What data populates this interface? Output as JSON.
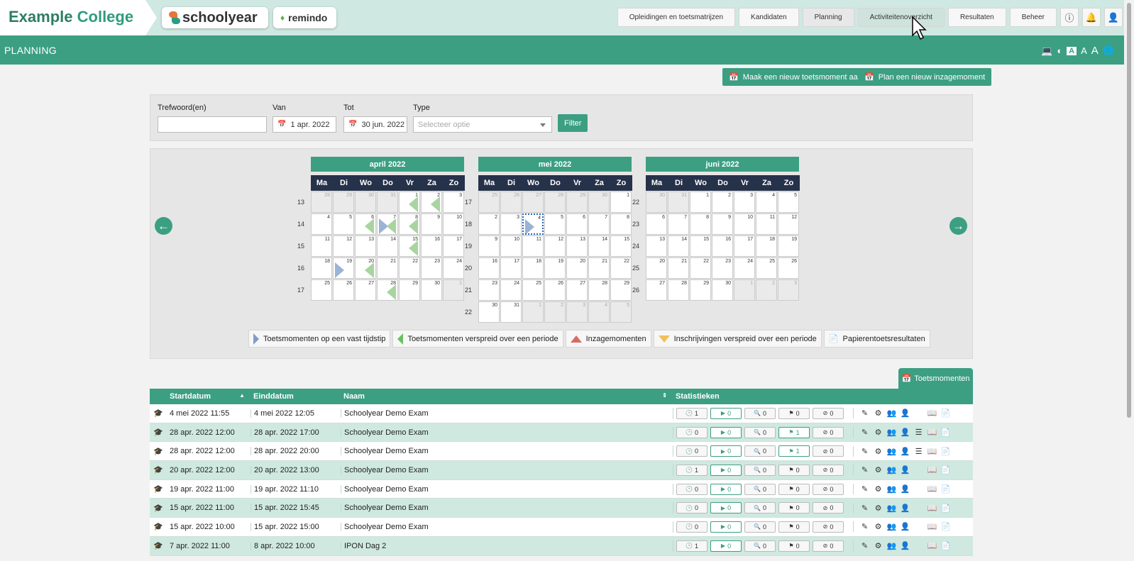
{
  "header": {
    "college_part1": "Example",
    "college_part2": "College",
    "logo_schoolyear": "schoolyear",
    "logo_remindo": "remindo",
    "nav": [
      {
        "label": "Opleidingen en toetsmatrijzen"
      },
      {
        "label": "Kandidaten"
      },
      {
        "label": "Planning"
      },
      {
        "label": "Activiteitenoverzicht"
      },
      {
        "label": "Resultaten"
      },
      {
        "label": "Beheer"
      }
    ],
    "nav_icons": [
      "info-icon",
      "bell-icon",
      "user-icon"
    ]
  },
  "subbar": {
    "title": "PLANNING",
    "tools": [
      "laptop-icon",
      "contrast-icon",
      "font-normal-icon",
      "font-large-icon",
      "font-larger-icon",
      "globe-icon"
    ]
  },
  "actions": {
    "new_test": "Maak een nieuw toetsmoment aan",
    "new_review": "Plan een nieuw inzagemoment"
  },
  "filter": {
    "keyword_label": "Trefwoord(en)",
    "keyword_value": "",
    "from_label": "Van",
    "from_value": "1 apr. 2022",
    "to_label": "Tot",
    "to_value": "30 jun. 2022",
    "type_label": "Type",
    "type_placeholder": "Selecteer optie",
    "filter_button": "Filter"
  },
  "calendar": {
    "day_headers": [
      "Ma",
      "Di",
      "Wo",
      "Do",
      "Vr",
      "Za",
      "Zo"
    ],
    "months": [
      {
        "title": "april 2022",
        "weeks": [
          {
            "wn": "13",
            "days": [
              [
                "28",
                0,
                ""
              ],
              [
                "29",
                0,
                ""
              ],
              [
                "30",
                0,
                ""
              ],
              [
                "31",
                0,
                ""
              ],
              [
                "1",
                1,
                "l"
              ],
              [
                "2",
                1,
                "l"
              ],
              [
                "3",
                1,
                ""
              ]
            ]
          },
          {
            "wn": "14",
            "days": [
              [
                "4",
                1,
                ""
              ],
              [
                "5",
                1,
                ""
              ],
              [
                "6",
                1,
                "l"
              ],
              [
                "7",
                1,
                "rl"
              ],
              [
                "8",
                1,
                "l"
              ],
              [
                "9",
                1,
                ""
              ],
              [
                "10",
                1,
                ""
              ]
            ]
          },
          {
            "wn": "15",
            "days": [
              [
                "11",
                1,
                ""
              ],
              [
                "12",
                1,
                ""
              ],
              [
                "13",
                1,
                ""
              ],
              [
                "14",
                1,
                ""
              ],
              [
                "15",
                1,
                "l"
              ],
              [
                "16",
                1,
                ""
              ],
              [
                "17",
                1,
                ""
              ]
            ]
          },
          {
            "wn": "16",
            "days": [
              [
                "18",
                1,
                ""
              ],
              [
                "19",
                1,
                "r"
              ],
              [
                "20",
                1,
                "l"
              ],
              [
                "21",
                1,
                ""
              ],
              [
                "22",
                1,
                ""
              ],
              [
                "23",
                1,
                ""
              ],
              [
                "24",
                1,
                ""
              ]
            ]
          },
          {
            "wn": "17",
            "days": [
              [
                "25",
                1,
                ""
              ],
              [
                "26",
                1,
                ""
              ],
              [
                "27",
                1,
                ""
              ],
              [
                "28",
                1,
                "l"
              ],
              [
                "29",
                1,
                ""
              ],
              [
                "30",
                1,
                ""
              ],
              [
                "1",
                0,
                ""
              ]
            ]
          }
        ]
      },
      {
        "title": "mei 2022",
        "weeks": [
          {
            "wn": "17",
            "days": [
              [
                "25",
                0,
                ""
              ],
              [
                "26",
                0,
                ""
              ],
              [
                "27",
                0,
                ""
              ],
              [
                "28",
                0,
                ""
              ],
              [
                "29",
                0,
                ""
              ],
              [
                "30",
                0,
                ""
              ],
              [
                "1",
                1,
                ""
              ]
            ]
          },
          {
            "wn": "18",
            "days": [
              [
                "2",
                1,
                ""
              ],
              [
                "3",
                1,
                ""
              ],
              [
                "4",
                1,
                "rs"
              ],
              [
                "5",
                1,
                ""
              ],
              [
                "6",
                1,
                ""
              ],
              [
                "7",
                1,
                ""
              ],
              [
                "8",
                1,
                ""
              ]
            ]
          },
          {
            "wn": "19",
            "days": [
              [
                "9",
                1,
                ""
              ],
              [
                "10",
                1,
                ""
              ],
              [
                "11",
                1,
                ""
              ],
              [
                "12",
                1,
                ""
              ],
              [
                "13",
                1,
                ""
              ],
              [
                "14",
                1,
                ""
              ],
              [
                "15",
                1,
                ""
              ]
            ]
          },
          {
            "wn": "20",
            "days": [
              [
                "16",
                1,
                ""
              ],
              [
                "17",
                1,
                ""
              ],
              [
                "18",
                1,
                ""
              ],
              [
                "19",
                1,
                ""
              ],
              [
                "20",
                1,
                ""
              ],
              [
                "21",
                1,
                ""
              ],
              [
                "22",
                1,
                ""
              ]
            ]
          },
          {
            "wn": "21",
            "days": [
              [
                "23",
                1,
                ""
              ],
              [
                "24",
                1,
                ""
              ],
              [
                "25",
                1,
                ""
              ],
              [
                "26",
                1,
                ""
              ],
              [
                "27",
                1,
                ""
              ],
              [
                "28",
                1,
                ""
              ],
              [
                "29",
                1,
                ""
              ]
            ]
          },
          {
            "wn": "22",
            "days": [
              [
                "30",
                1,
                ""
              ],
              [
                "31",
                1,
                ""
              ],
              [
                "1",
                0,
                ""
              ],
              [
                "2",
                0,
                ""
              ],
              [
                "3",
                0,
                ""
              ],
              [
                "4",
                0,
                ""
              ],
              [
                "5",
                0,
                ""
              ]
            ]
          }
        ]
      },
      {
        "title": "juni 2022",
        "weeks": [
          {
            "wn": "22",
            "days": [
              [
                "30",
                0,
                ""
              ],
              [
                "31",
                0,
                ""
              ],
              [
                "1",
                1,
                ""
              ],
              [
                "2",
                1,
                ""
              ],
              [
                "3",
                1,
                ""
              ],
              [
                "4",
                1,
                ""
              ],
              [
                "5",
                1,
                ""
              ]
            ]
          },
          {
            "wn": "23",
            "days": [
              [
                "6",
                1,
                ""
              ],
              [
                "7",
                1,
                ""
              ],
              [
                "8",
                1,
                ""
              ],
              [
                "9",
                1,
                ""
              ],
              [
                "10",
                1,
                ""
              ],
              [
                "11",
                1,
                ""
              ],
              [
                "12",
                1,
                ""
              ]
            ]
          },
          {
            "wn": "24",
            "days": [
              [
                "13",
                1,
                ""
              ],
              [
                "14",
                1,
                ""
              ],
              [
                "15",
                1,
                ""
              ],
              [
                "16",
                1,
                ""
              ],
              [
                "17",
                1,
                ""
              ],
              [
                "18",
                1,
                ""
              ],
              [
                "19",
                1,
                ""
              ]
            ]
          },
          {
            "wn": "25",
            "days": [
              [
                "20",
                1,
                ""
              ],
              [
                "21",
                1,
                ""
              ],
              [
                "22",
                1,
                ""
              ],
              [
                "23",
                1,
                ""
              ],
              [
                "24",
                1,
                ""
              ],
              [
                "25",
                1,
                ""
              ],
              [
                "26",
                1,
                ""
              ]
            ]
          },
          {
            "wn": "26",
            "days": [
              [
                "27",
                1,
                ""
              ],
              [
                "28",
                1,
                ""
              ],
              [
                "29",
                1,
                ""
              ],
              [
                "30",
                1,
                ""
              ],
              [
                "1",
                0,
                ""
              ],
              [
                "2",
                0,
                ""
              ],
              [
                "3",
                0,
                ""
              ]
            ]
          }
        ]
      }
    ]
  },
  "legend": {
    "fixed": "Toetsmomenten op een vast tijdstip",
    "spread": "Toetsmomenten verspreid over een periode",
    "review": "Inzagemomenten",
    "registrations": "Inschrijvingen verspreid over een periode",
    "paper": "Papierentoetsresultaten"
  },
  "table": {
    "tab_label": "Toetsmomenten",
    "headers": {
      "start": "Startdatum",
      "end": "Einddatum",
      "name": "Naam",
      "stats": "Statistieken"
    },
    "rows": [
      {
        "start": "4 mei 2022 11:55",
        "end": "4 mei 2022 12:05",
        "name": "Schoolyear Demo Exam",
        "s": [
          "1",
          "0",
          "0",
          "0",
          "0"
        ],
        "flag_green": false,
        "list": false
      },
      {
        "start": "28 apr. 2022 12:00",
        "end": "28 apr. 2022 17:00",
        "name": "Schoolyear Demo Exam",
        "s": [
          "0",
          "0",
          "0",
          "1",
          "0"
        ],
        "flag_green": true,
        "list": true
      },
      {
        "start": "28 apr. 2022 12:00",
        "end": "28 apr. 2022 20:00",
        "name": "Schoolyear Demo Exam",
        "s": [
          "0",
          "0",
          "0",
          "1",
          "0"
        ],
        "flag_green": true,
        "list": true
      },
      {
        "start": "20 apr. 2022 12:00",
        "end": "20 apr. 2022 13:00",
        "name": "Schoolyear Demo Exam",
        "s": [
          "1",
          "0",
          "0",
          "0",
          "0"
        ],
        "flag_green": false,
        "list": false
      },
      {
        "start": "19 apr. 2022 11:00",
        "end": "19 apr. 2022 11:10",
        "name": "Schoolyear Demo Exam",
        "s": [
          "0",
          "0",
          "0",
          "0",
          "0"
        ],
        "flag_green": false,
        "list": false
      },
      {
        "start": "15 apr. 2022 11:00",
        "end": "15 apr. 2022 15:45",
        "name": "Schoolyear Demo Exam",
        "s": [
          "0",
          "0",
          "0",
          "0",
          "0"
        ],
        "flag_green": false,
        "list": false
      },
      {
        "start": "15 apr. 2022 10:00",
        "end": "15 apr. 2022 15:00",
        "name": "Schoolyear Demo Exam",
        "s": [
          "0",
          "0",
          "0",
          "0",
          "0"
        ],
        "flag_green": false,
        "list": false
      },
      {
        "start": "7 apr. 2022 11:00",
        "end": "8 apr. 2022 10:00",
        "name": "IPON Dag 2",
        "s": [
          "1",
          "0",
          "0",
          "0",
          "0"
        ],
        "flag_green": false,
        "list": false
      }
    ]
  }
}
